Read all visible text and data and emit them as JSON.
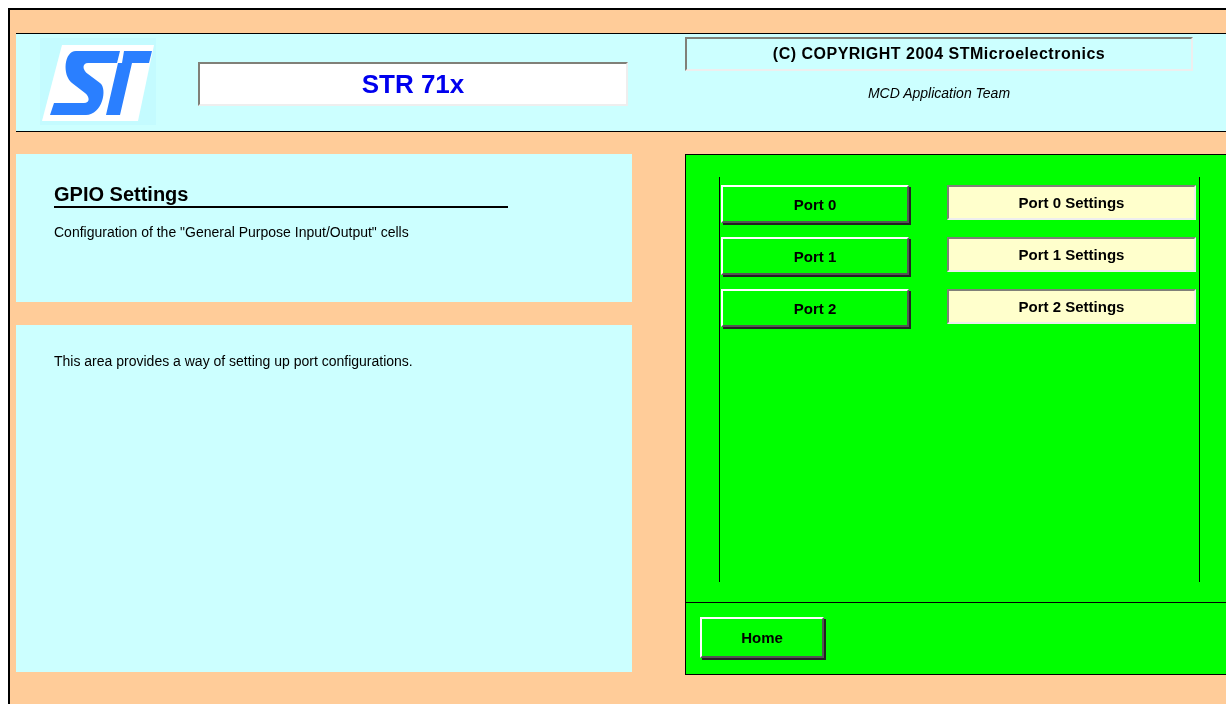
{
  "header": {
    "title": "STR 71x",
    "copyright": "(C) COPYRIGHT 2004 STMicroelectronics",
    "team": "MCD Application Team"
  },
  "intro": {
    "heading": "GPIO Settings",
    "description": "Configuration of the \"General Purpose Input/Output\" cells"
  },
  "info": {
    "text": "This area provides a way of setting up port configurations."
  },
  "ports": [
    {
      "button": "Port 0",
      "settings": "Port 0 Settings"
    },
    {
      "button": "Port 1",
      "settings": "Port 1 Settings"
    },
    {
      "button": "Port 2",
      "settings": "Port 2 Settings"
    }
  ],
  "home_button": "Home"
}
